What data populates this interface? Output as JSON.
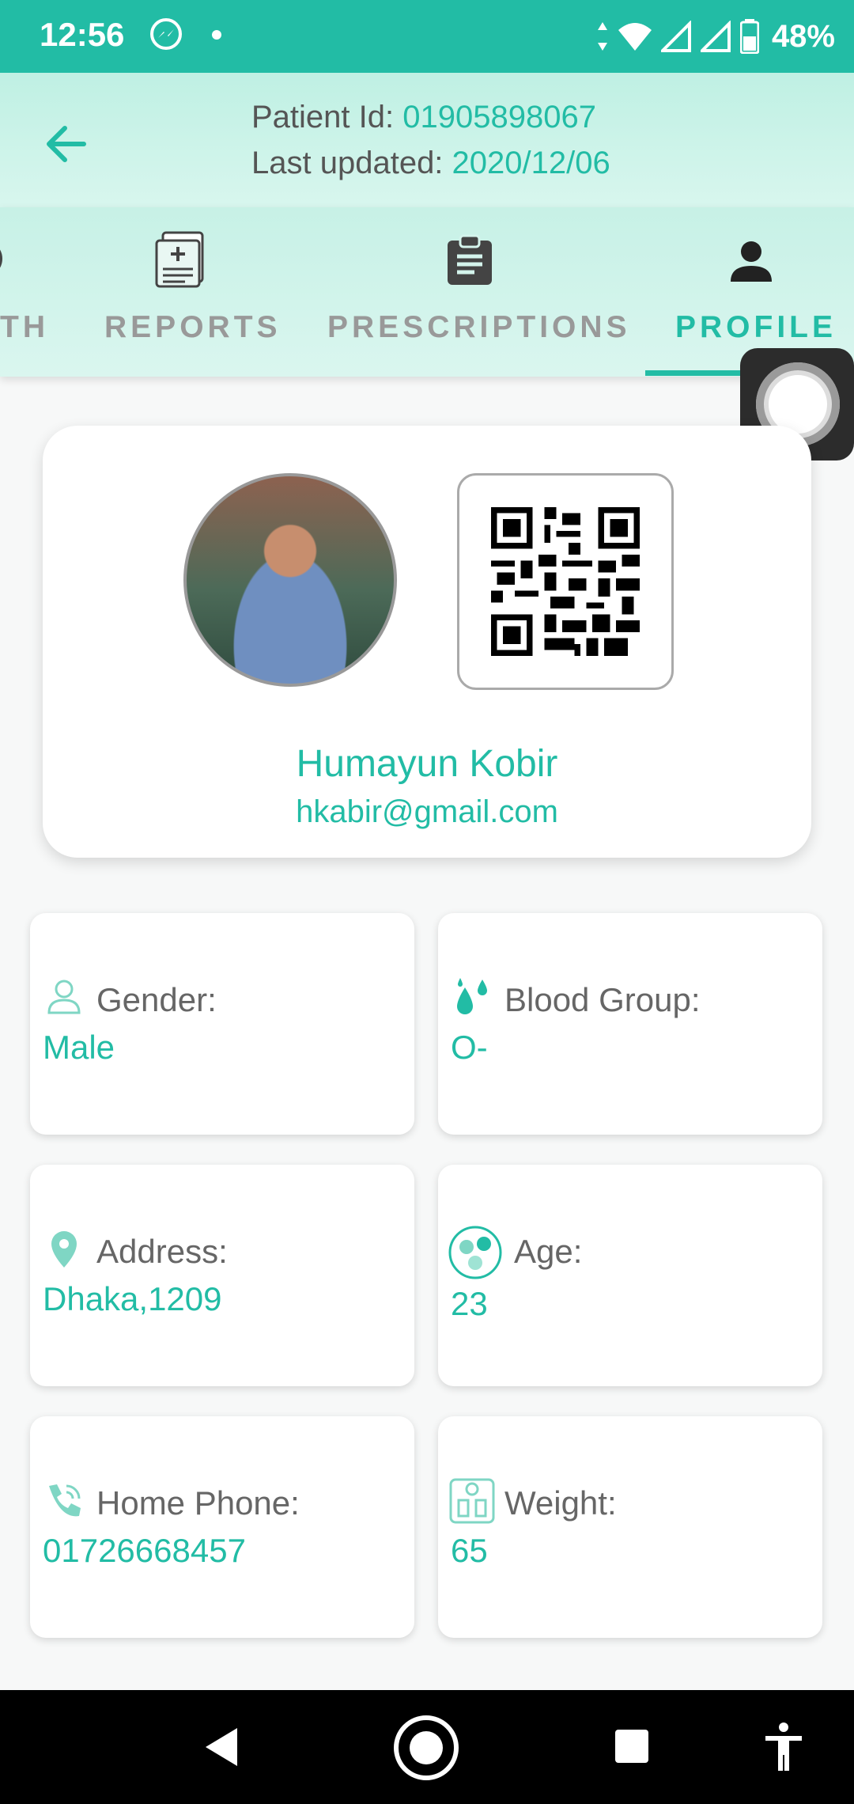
{
  "status_bar": {
    "time": "12:56",
    "battery": "48%"
  },
  "header": {
    "patient_id_label": "Patient Id: ",
    "patient_id": "01905898067",
    "last_updated_label": "Last updated: ",
    "last_updated": "2020/12/06"
  },
  "tabs": [
    {
      "label": "TH",
      "icon": "partial-tab"
    },
    {
      "label": "REPORTS",
      "icon": "medical-report-icon"
    },
    {
      "label": "PRESCRIPTIONS",
      "icon": "clipboard-icon"
    },
    {
      "label": "PROFILE",
      "icon": "person-icon",
      "active": true
    }
  ],
  "profile": {
    "name": "Humayun Kobir",
    "email": "hkabir@gmail.com"
  },
  "info": {
    "gender_label": "Gender:",
    "gender": "Male",
    "blood_label": "Blood Group:",
    "blood": "O-",
    "address_label": "Address:",
    "address": "Dhaka,1209",
    "age_label": "Age:",
    "age": "23",
    "phone_label": "Home Phone:",
    "phone": "01726668457",
    "weight_label": "Weight:",
    "weight": "65"
  },
  "colors": {
    "accent": "#22bca5",
    "header_bg": "#c7f1e6",
    "nav_bg": "#000000"
  }
}
